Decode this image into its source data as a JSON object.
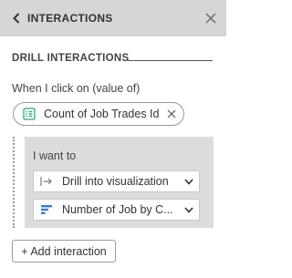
{
  "header": {
    "title": "INTERACTIONS",
    "back_icon": "chevron-left-icon",
    "close_icon": "close-icon"
  },
  "section": {
    "title": "DRILL INTERACTIONS"
  },
  "trigger": {
    "label": "When I click on (value of)",
    "chip_label": "Count of Job Trades Id",
    "chip_icon": "field-list-icon",
    "chip_remove_icon": "close-icon"
  },
  "action": {
    "label": "I want to",
    "action_select": {
      "value": "Drill into visualization",
      "icon": "drill-arrow-icon"
    },
    "target_select": {
      "value": "Number of Job by C...",
      "icon": "bar-chart-icon"
    }
  },
  "add_interaction": {
    "label": "+ Add interaction"
  },
  "colors": {
    "header_bg": "#d6d6d6",
    "action_box_bg": "#dcdcdc",
    "field_icon": "#2aa876",
    "chart_icon": "#3b7cc4"
  }
}
